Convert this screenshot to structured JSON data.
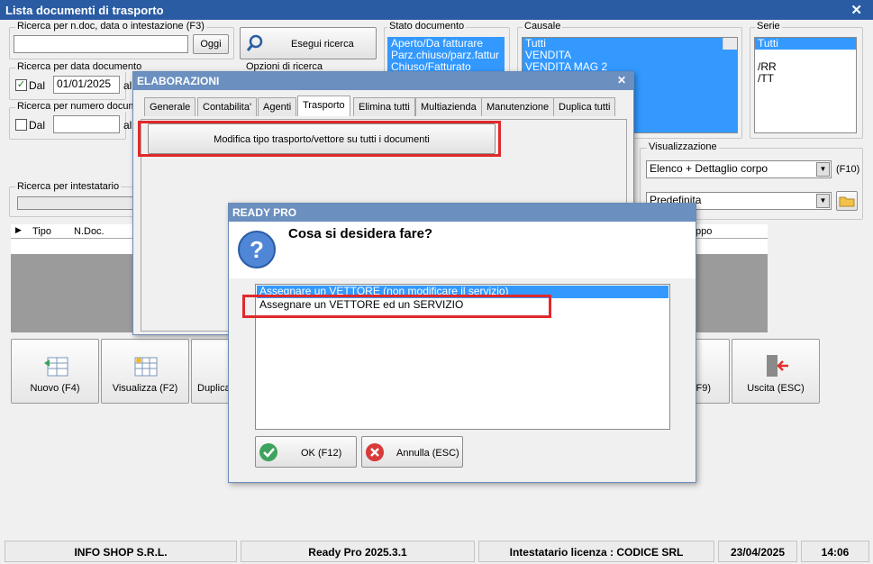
{
  "window": {
    "title": "Lista documenti di trasporto",
    "close": "✕"
  },
  "search": {
    "ndoc_label": "Ricerca per n.doc, data o intestazione (F3)",
    "ndoc_value": "",
    "oggi": "Oggi",
    "esegui": "Esegui ricerca",
    "data_label": "Ricerca per data documento",
    "dal_label": "Dal",
    "dal_value": "01/01/2025",
    "al_label": "al",
    "opzioni_label": "Opzioni di ricerca",
    "numero_label": "Ricerca per numero docum",
    "dal2_label": "Dal",
    "al2_label": "al",
    "intestatario_label": "Ricerca per intestatario"
  },
  "stato": {
    "label": "Stato documento",
    "items": [
      "Aperto/Da fatturare",
      "Parz.chiuso/parz.fattur",
      "Chiuso/Fatturato"
    ]
  },
  "causale": {
    "label": "Causale",
    "items": [
      "Tutti",
      "VENDITA",
      "VENDITA MAG 2"
    ]
  },
  "serie": {
    "label": "Serie",
    "items": [
      "Tutti",
      "",
      "/RR",
      "/TT"
    ]
  },
  "visualizzazione": {
    "label": "Visualizzazione",
    "value": "Elenco + Dettaglio corpo",
    "key": "(F10)",
    "preset": "Predefinita"
  },
  "grid": {
    "col_tipo": "Tipo",
    "col_ndoc": "N.Doc.",
    "col_gruppo": "ppo"
  },
  "buttons": {
    "nuovo": "Nuovo (F4)",
    "visualizza": "Visualizza (F2)",
    "duplica": "Duplica",
    "f9": "(F9)",
    "uscita": "Uscita (ESC)"
  },
  "elaborazioni": {
    "title": "ELABORAZIONI",
    "close": "✕",
    "tabs": [
      "Generale",
      "Contabilita'",
      "Agenti",
      "Trasporto",
      "Elimina tutti",
      "Multiazienda",
      "Manutenzione",
      "Duplica tutti"
    ],
    "action": "Modifica tipo trasporto/vettore su tutti i documenti"
  },
  "readypro": {
    "title": "READY PRO",
    "question": "Cosa si desidera fare?",
    "options": [
      "Assegnare un VETTORE (non modificare il servizio)",
      "Assegnare un VETTORE ed un SERVIZIO"
    ],
    "ok": "OK (F12)",
    "annulla": "Annulla (ESC)"
  },
  "status": {
    "company": "INFO SHOP S.R.L.",
    "version": "Ready Pro 2025.3.1",
    "license": "Intestatario licenza : CODICE SRL",
    "date": "23/04/2025",
    "time": "14:06"
  },
  "colors": {
    "title_bar": "#2a5ca3",
    "selection": "#3399ff",
    "highlight_box": "#e0292b"
  }
}
